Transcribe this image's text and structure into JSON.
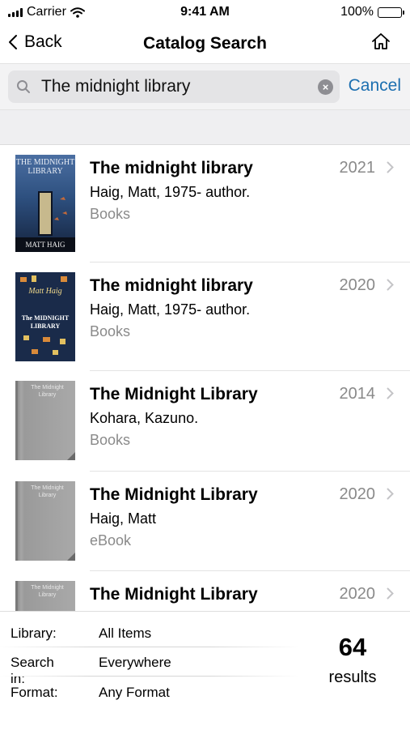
{
  "status_bar": {
    "carrier": "Carrier",
    "time": "9:41 AM",
    "battery": "100%"
  },
  "nav": {
    "back_label": "Back",
    "title": "Catalog Search",
    "home_icon": "home-icon"
  },
  "search": {
    "query": "The midnight library",
    "cancel_label": "Cancel",
    "icon": "search-icon"
  },
  "results": [
    {
      "title": "The midnight library",
      "author": "Haig, Matt, 1975- author.",
      "format": "Books",
      "year": "2021",
      "cover": {
        "title_text": "THE MIDNIGHT LIBRARY",
        "author_text": "MATT HAIG"
      }
    },
    {
      "title": "The midnight library",
      "author": "Haig, Matt, 1975- author.",
      "format": "Books",
      "year": "2020",
      "cover": {
        "title_text": "The MIDNIGHT LIBRARY",
        "author_text": "Matt Haig"
      }
    },
    {
      "title": "The Midnight Library",
      "author": "Kohara, Kazuno.",
      "format": "Books",
      "year": "2014",
      "cover": {
        "title_text": "The Midnight Library"
      }
    },
    {
      "title": "The Midnight Library",
      "author": "Haig, Matt",
      "format": "eBook",
      "year": "2020",
      "cover": {
        "title_text": "The Midnight Library"
      }
    },
    {
      "title": "The Midnight Library",
      "author": "",
      "format": "",
      "year": "2020",
      "cover": {
        "title_text": "The Midnight Library"
      }
    }
  ],
  "footer": {
    "library_label": "Library:",
    "library_value": "All Items",
    "search_in_label": "Search in:",
    "search_in_value": "Everywhere",
    "format_label": "Format:",
    "format_value": "Any Format",
    "result_count": "64",
    "result_count_label": "results"
  },
  "colors": {
    "accent": "#1c6fb0",
    "secondary_text": "#8a8a8a",
    "search_field": "#e4e4e6"
  }
}
